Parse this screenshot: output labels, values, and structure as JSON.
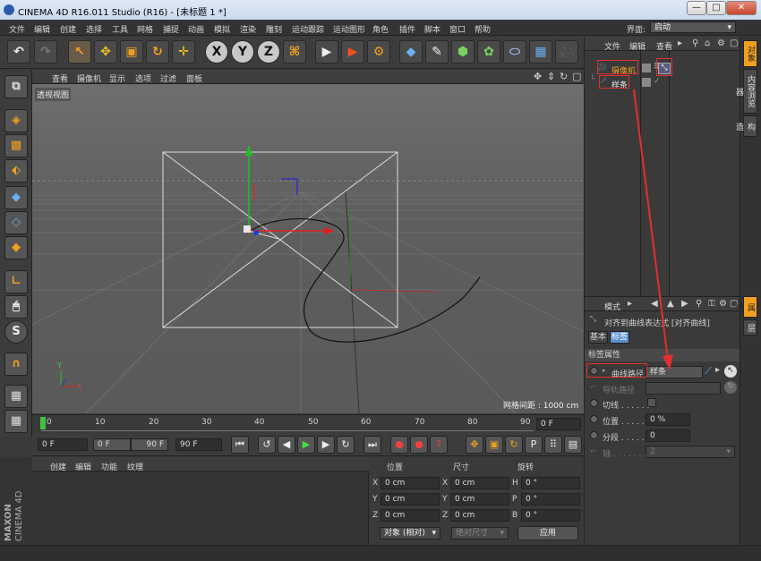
{
  "window": {
    "title": "CINEMA 4D R16.011 Studio (R16) - [未标题 1 *]",
    "minimize": "—",
    "maximize": "□",
    "close": "✕"
  },
  "menu": [
    "文件",
    "编辑",
    "创建",
    "选择",
    "工具",
    "网格",
    "捕捉",
    "动画",
    "模拟",
    "渲染",
    "雕刻",
    "运动跟踪",
    "运动图形",
    "角色",
    "插件",
    "脚本",
    "窗口",
    "帮助"
  ],
  "layout": {
    "label": "界面:",
    "value": "启动"
  },
  "viewport": {
    "menu": [
      "查看",
      "摄像机",
      "显示",
      "选项",
      "过滤",
      "面板"
    ],
    "name": "透视视图",
    "grid_spacing": "网格间距 : 1000 cm",
    "axis_y": "Y",
    "axis_x": "X"
  },
  "timeline": {
    "ticks": [
      "0",
      "10",
      "20",
      "30",
      "40",
      "50",
      "60",
      "70",
      "80",
      "90"
    ],
    "current_frame": "0 F"
  },
  "transport": {
    "start": "0 F",
    "range_start": "0 F",
    "range_end": "90 F",
    "end": "90 F"
  },
  "materials": {
    "menu": [
      "创建",
      "编辑",
      "功能",
      "纹理"
    ],
    "logo_line1": "MAXON",
    "logo_line2": "CINEMA 4D"
  },
  "coords": {
    "headers": [
      "位置",
      "尺寸",
      "旋转"
    ],
    "rows": [
      {
        "label": "X",
        "pos": "0 cm",
        "size_label": "X",
        "size": "0 cm",
        "rot_label": "H",
        "rot": "0 °"
      },
      {
        "label": "Y",
        "pos": "0 cm",
        "size_label": "Y",
        "size": "0 cm",
        "rot_label": "P",
        "rot": "0 °"
      },
      {
        "label": "Z",
        "pos": "0 cm",
        "size_label": "Z",
        "size": "0 cm",
        "rot_label": "B",
        "rot": "0 °"
      }
    ],
    "mode": "对象 (相对)",
    "size_mode": "绝对尺寸",
    "apply": "应用"
  },
  "object_manager": {
    "menu": [
      "文件",
      "编辑",
      "查看"
    ],
    "objects": [
      {
        "name": "摄像机",
        "color": "#f0a020"
      },
      {
        "name": "样条",
        "color": "#e6e6e6"
      }
    ]
  },
  "attribute_manager": {
    "menu": "模式",
    "tag_name": "对齐到曲线表达式 [对齐曲线]",
    "tabs": [
      "基本",
      "标签"
    ],
    "section": "标签属性",
    "fields": [
      {
        "label": "曲线路径",
        "value": "样条"
      },
      {
        "label": "导轨路径",
        "value": ""
      },
      {
        "label": "切线 . . . . . .",
        "value": ""
      },
      {
        "label": "位置 . . . . . .",
        "value": "0 %"
      },
      {
        "label": "分段 . . . . . .",
        "value": "0"
      },
      {
        "label": "轴 . . . . . . . .",
        "value": "Z"
      }
    ]
  },
  "side_tabs": [
    "对象",
    "内容浏览器",
    "构造",
    "属性",
    "层"
  ],
  "colors": {
    "accent": "#f0a020",
    "annotation": "#e03030",
    "selected_tab": "#5a8fd0"
  }
}
